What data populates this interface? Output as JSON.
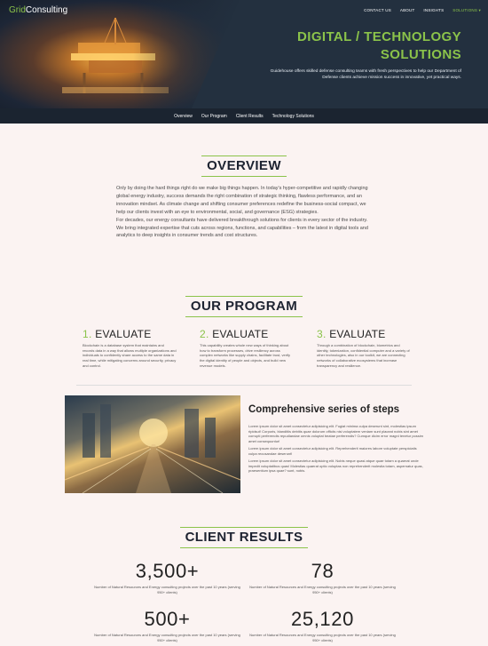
{
  "header": {
    "brand_part1": "Grid",
    "brand_part2": "Consulting",
    "nav": [
      "CONTACT US",
      "ABOUT",
      "INSIGHTS",
      "SOLUTIONS ▾"
    ],
    "hero_title": "DIGITAL / TECHNOLOGY SOLUTIONS",
    "hero_description": "Guidehouse offers skilled defense consulting teams with fresh perspectives to help our Department of Defense clients achieve mission success in innovative, yet practical ways."
  },
  "subnav": [
    "Overview",
    "Our Program",
    "Client Results",
    "Technology Solutions"
  ],
  "overview": {
    "title": "OVERVIEW",
    "paragraph1": "Only by doing the hard things right do we make big things happen. In today's hyper-competitive and rapidly changing global energy industry, success demands the right combination of strategic thinking, flawless performance, and an innovation mindset. As climate change and shifting consumer preferences redefine the business-social compact, we help our clients invest with an eye to environmental, social, and governance (ESG) strategies.",
    "paragraph2": "For decades, our energy consultants have delivered breakthrough solutions for clients in every sector of the industry. We bring integrated expertise that cuts across regions, functions, and capabilities – from the latest in digital tools and analytics to deep insights in consumer trends and cost structures."
  },
  "program": {
    "title": "OUR PROGRAM",
    "steps": [
      {
        "num": "1.",
        "label": "EVALUATE",
        "text": "Blockchain is a database system that maintains and records data in a way that allows multiple organizations and individuals to confidently share access to the same data in real time, while mitigating concerns around security, privacy and control."
      },
      {
        "num": "2.",
        "label": "EVALUATE",
        "text": "This capability creates whole new ways of thinking about how to transform processes, drive resiliency across complex networks like supply chains, facilitate trust, verify the digital identity of people and objects, and build new revenue models."
      },
      {
        "num": "3.",
        "label": "EVALUATE",
        "text": "Through a combination of blockchain, biometrics and identity, tokenization, confidential computer and a variety of other technologies, also in our toolkit, we are connecting networks of collaborative ecosystems that increase transparency and resilience."
      }
    ],
    "feature_title": "Comprehensive series of steps",
    "feature_paragraphs": [
      "Lorem ipsum dolor sit amet consectetur adipisicing elit. Fugiat minima culpa deserunt sint, molestias ipsum ripidsut! Corporis, blanditiis debitis quae dolorum officiis nisi voluptatem veniam sunt placeat nobis sint amet corrupti perferendis repudiandae omnis voluptat beatae perferendis? Cumque dicim error magni tenetur possim amet consequuntur!",
      "Lorem ipsum dolor sit amet consectetur adipisicing elit. Reprehenderit maiores labore voluptate perspiciatis culpa recusandae deserunt!",
      "Lorem ipsum dolor sit amet consectetur adipisicing elit. Nobis neque quasi atque quae totam a quaerat unde impedit voluptatibus quas! Molestias quaerat optio voluptas non reprehenderit molestia totam, aspernatur quas, praesentium ipsa quae? sunt, nobis."
    ]
  },
  "results": {
    "title": "CLIENT RESULTS",
    "stats": [
      {
        "value": "3,500+",
        "label": "Number of Natural Resources and Energy consulting projects over the past 10 years (serving 950+ clients)"
      },
      {
        "value": "78",
        "label": "Number of Natural Resources and Energy consulting projects over the past 10 years (serving 950+ clients)"
      },
      {
        "value": "500+",
        "label": "Number of Natural Resources and Energy consulting projects over the past 10 years (serving 950+ clients)"
      },
      {
        "value": "25,120",
        "label": "Number of Natural Resources and Energy consulting projects over the past 10 years (serving 950+ clients)"
      }
    ]
  },
  "colors": {
    "accent": "#8bc34a",
    "hero_bg": "#23303f",
    "page_bg": "#fbf3f2"
  }
}
